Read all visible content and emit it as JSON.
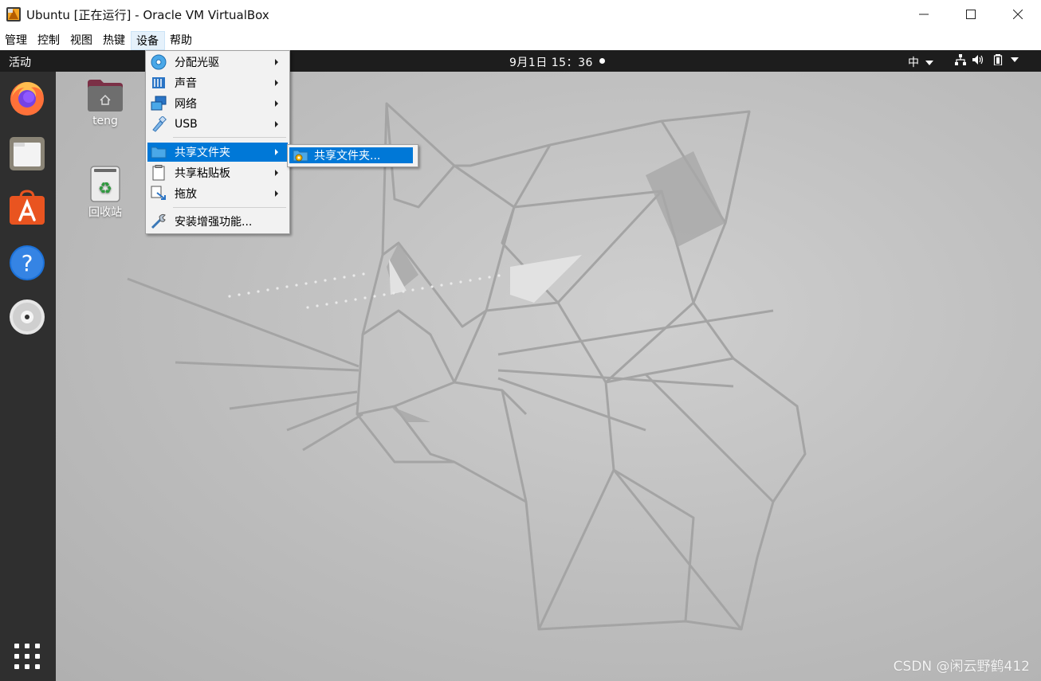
{
  "window": {
    "title": "Ubuntu [正在运行] - Oracle VM VirtualBox",
    "controls": {
      "minimize": "minimize-icon",
      "maximize": "maximize-icon",
      "close": "close-icon"
    }
  },
  "menubar": {
    "items": [
      {
        "label": "管理"
      },
      {
        "label": "控制"
      },
      {
        "label": "视图"
      },
      {
        "label": "热键"
      },
      {
        "label": "设备",
        "active": true
      },
      {
        "label": "帮助"
      }
    ]
  },
  "devices_menu": {
    "items": [
      {
        "label": "分配光驱",
        "icon": "optical-disc-icon",
        "submenu": true
      },
      {
        "label": "声音",
        "icon": "audio-icon",
        "submenu": true
      },
      {
        "label": "网络",
        "icon": "network-icon",
        "submenu": true
      },
      {
        "label": "USB",
        "icon": "usb-icon",
        "submenu": true
      },
      {
        "label": "共享文件夹",
        "icon": "shared-folder-icon",
        "submenu": true,
        "selected": true
      },
      {
        "label": "共享粘贴板",
        "icon": "clipboard-icon",
        "submenu": true
      },
      {
        "label": "拖放",
        "icon": "drag-drop-icon",
        "submenu": true
      },
      {
        "label": "安装增强功能...",
        "icon": "guest-additions-icon",
        "submenu": false
      }
    ],
    "submenu": {
      "label": "共享文件夹...",
      "icon": "shared-folder-settings-icon"
    }
  },
  "ubuntu_topbar": {
    "activities": "活动",
    "clock": "9月1日 15：36",
    "input_method": "中",
    "tray_icons": [
      "network-wired-icon",
      "volume-icon",
      "battery-icon",
      "system-menu-arrow-icon"
    ]
  },
  "dock": {
    "items": [
      {
        "name": "firefox-icon"
      },
      {
        "name": "files-icon"
      },
      {
        "name": "ubuntu-software-icon"
      },
      {
        "name": "help-icon"
      },
      {
        "name": "dvd-icon"
      },
      {
        "name": "show-applications-icon"
      }
    ]
  },
  "desktop": {
    "icons": [
      {
        "label": "teng",
        "icon": "home-folder-icon"
      },
      {
        "label": "回收站",
        "icon": "trash-icon"
      }
    ],
    "watermark": "CSDN @闲云野鹤412"
  },
  "colors": {
    "menu_highlight": "#0078d7",
    "topbar": "#1d1d1d",
    "dock": "#2f2f2f",
    "ubuntu_orange": "#e95420"
  }
}
